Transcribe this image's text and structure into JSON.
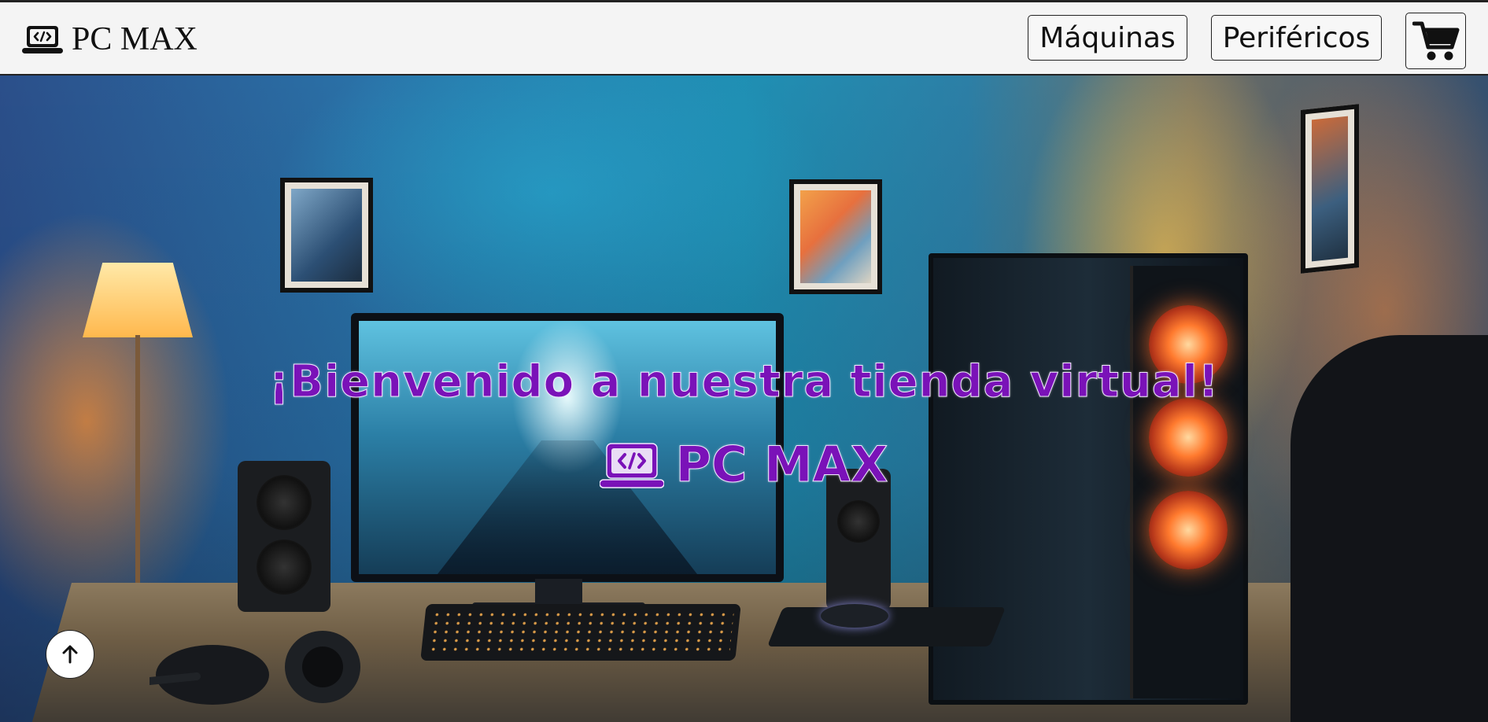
{
  "header": {
    "brand": "PC MAX",
    "brand_icon": "laptop-code-icon",
    "nav": [
      {
        "label": "Máquinas"
      },
      {
        "label": "Periféricos"
      }
    ],
    "cart_icon": "shopping-cart-icon"
  },
  "hero": {
    "title": "¡Bienvenido a nuestra tienda virtual!",
    "brand": "PC MAX",
    "brand_icon": "laptop-code-icon",
    "title_color": "#7a12b8",
    "background_image": "gaming-pc-setup-room"
  },
  "scroll_top": {
    "icon": "arrow-up-icon"
  }
}
